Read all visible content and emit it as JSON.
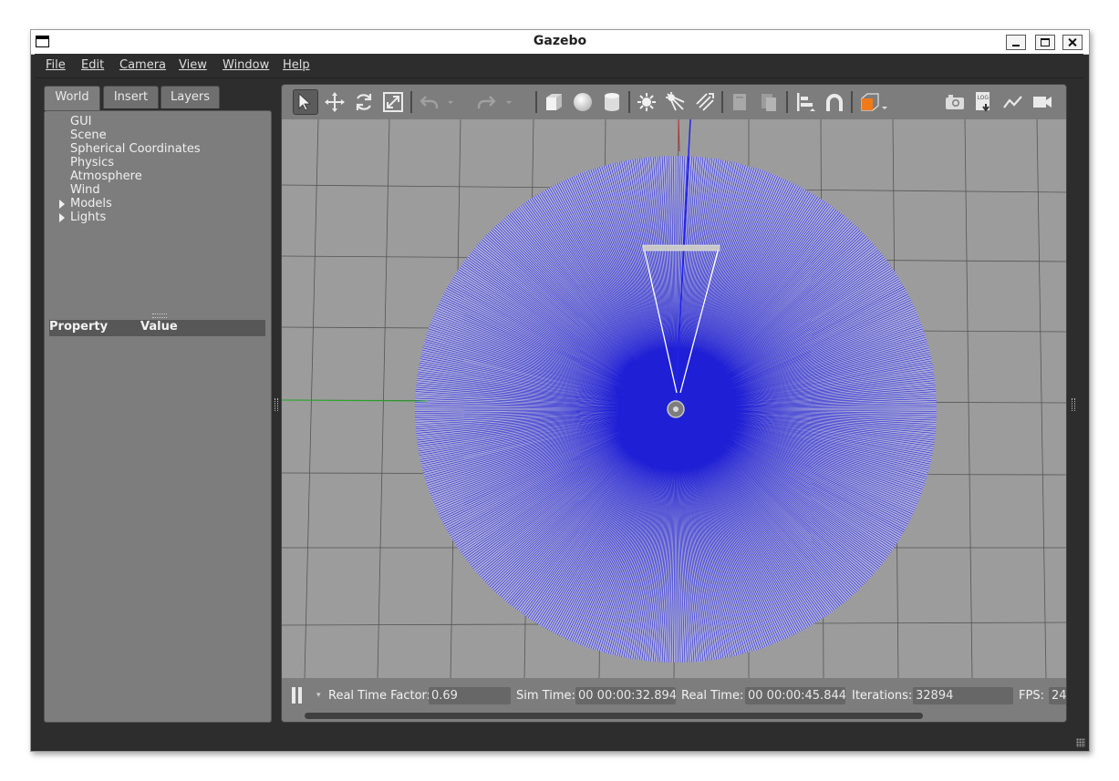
{
  "window": {
    "title": "Gazebo"
  },
  "menu": [
    {
      "label": "File"
    },
    {
      "label": "Edit"
    },
    {
      "label": "Camera"
    },
    {
      "label": "View"
    },
    {
      "label": "Window"
    },
    {
      "label": "Help"
    }
  ],
  "left_panel": {
    "tabs": [
      {
        "label": "World",
        "active": true
      },
      {
        "label": "Insert",
        "active": false
      },
      {
        "label": "Layers",
        "active": false
      }
    ],
    "tree": [
      {
        "label": "GUI",
        "expandable": false
      },
      {
        "label": "Scene",
        "expandable": false
      },
      {
        "label": "Spherical Coordinates",
        "expandable": false
      },
      {
        "label": "Physics",
        "expandable": false
      },
      {
        "label": "Atmosphere",
        "expandable": false
      },
      {
        "label": "Wind",
        "expandable": false
      },
      {
        "label": "Models",
        "expandable": true
      },
      {
        "label": "Lights",
        "expandable": true
      }
    ],
    "property_header": {
      "property": "Property",
      "value": "Value"
    }
  },
  "toolbar": {
    "tools": [
      {
        "icon": "select-arrow-icon",
        "active": true
      },
      {
        "icon": "translate-icon"
      },
      {
        "icon": "rotate-icon"
      },
      {
        "icon": "scale-icon"
      },
      {
        "icon": "undo-icon"
      },
      {
        "icon": "undo-history-icon"
      },
      {
        "icon": "redo-icon"
      },
      {
        "icon": "redo-history-icon"
      },
      {
        "icon": "box-shape-icon"
      },
      {
        "icon": "sphere-shape-icon"
      },
      {
        "icon": "cylinder-shape-icon"
      },
      {
        "icon": "point-light-icon"
      },
      {
        "icon": "spot-light-icon"
      },
      {
        "icon": "directional-light-icon"
      },
      {
        "icon": "copy-icon"
      },
      {
        "icon": "paste-icon"
      },
      {
        "icon": "align-icon"
      },
      {
        "icon": "snap-magnet-icon"
      },
      {
        "icon": "view-angle-cube-icon"
      },
      {
        "icon": "screenshot-camera-icon"
      },
      {
        "icon": "log-record-icon"
      },
      {
        "icon": "plot-icon"
      },
      {
        "icon": "video-record-icon"
      }
    ],
    "colors": {
      "accent": "#f07a1a",
      "icon": "#e6e6e6"
    }
  },
  "scene": {
    "background": "#9c9c9c",
    "ray_color": "#1f1fd6",
    "axis_x_color": "#cc2222",
    "axis_y_color": "#22aa22",
    "axis_z_color": "#2222ee"
  },
  "status": {
    "rtf_label": "Real Time Factor:",
    "rtf_value": "0.69",
    "sim_label": "Sim Time:",
    "sim_value": "00 00:00:32.894",
    "real_label": "Real Time:",
    "real_value": "00 00:00:45.844",
    "iter_label": "Iterations:",
    "iter_value": "32894",
    "fps_label": "FPS:",
    "fps_value": "24"
  }
}
